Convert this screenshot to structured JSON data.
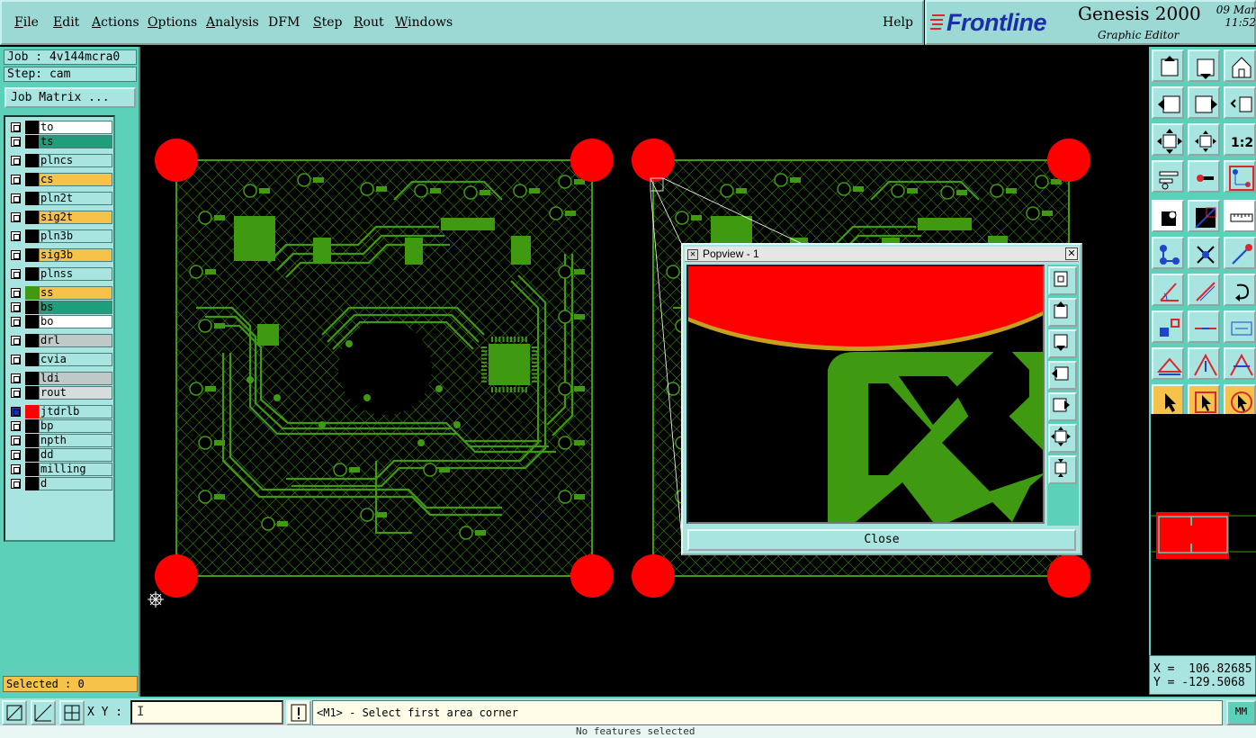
{
  "menubar": {
    "items": [
      {
        "label": "File",
        "u": "F",
        "rest": "ile"
      },
      {
        "label": "Edit",
        "u": "E",
        "rest": "dit"
      },
      {
        "label": "Actions",
        "u": "A",
        "rest": "ctions"
      },
      {
        "label": "Options",
        "u": "O",
        "rest": "ptions"
      },
      {
        "label": "Analysis",
        "u": "A",
        "rest": "nalysis"
      },
      {
        "label": "DFM",
        "u": "",
        "rest": "DFM"
      },
      {
        "label": "Step",
        "u": "S",
        "rest": "tep"
      },
      {
        "label": "Rout",
        "u": "R",
        "rest": "out"
      },
      {
        "label": "Windows",
        "u": "W",
        "rest": "indows"
      }
    ],
    "help": "Help"
  },
  "brand": {
    "logo": "Frontline",
    "title": "Genesis 2000",
    "subtitle": "Graphic Editor",
    "date": "09 Mar",
    "time": "11:52"
  },
  "job": {
    "job_line": "Job : 4v144mcra0",
    "step_line": "Step: cam",
    "matrix_button": "Job Matrix ..."
  },
  "layers": [
    {
      "name": "to",
      "bg": "#ffffff",
      "swatch": "#000000"
    },
    {
      "name": "ts",
      "bg": "#1e9e7a",
      "swatch": "#000000"
    },
    {
      "name": "plncs",
      "bg": "#a8e4e0",
      "swatch": "#000000"
    },
    {
      "name": "cs",
      "bg": "#f6c24a",
      "swatch": "#000000"
    },
    {
      "name": "pln2t",
      "bg": "#a8e4e0",
      "swatch": "#000000"
    },
    {
      "name": "sig2t",
      "bg": "#f6c24a",
      "swatch": "#000000"
    },
    {
      "name": "pln3b",
      "bg": "#a8e4e0",
      "swatch": "#000000"
    },
    {
      "name": "sig3b",
      "bg": "#f6c24a",
      "swatch": "#000000"
    },
    {
      "name": "plnss",
      "bg": "#a8e4e0",
      "swatch": "#000000"
    },
    {
      "name": "ss",
      "bg": "#f6c24a",
      "swatch": "#3f9a12"
    },
    {
      "name": "bs",
      "bg": "#1e9e7a",
      "swatch": "#000000"
    },
    {
      "name": "bo",
      "bg": "#ffffff",
      "swatch": "#000000"
    },
    {
      "name": "drl",
      "bg": "#c0c8c8",
      "swatch": "#000000"
    },
    {
      "name": "cvia",
      "bg": "#a8e4e0",
      "swatch": "#000000"
    },
    {
      "name": "ldi",
      "bg": "#c0c8c8",
      "swatch": "#000000"
    },
    {
      "name": "rout",
      "bg": "#d8dcdc",
      "swatch": "#000000"
    },
    {
      "name": "jtdrlb",
      "bg": "#a8e4e0",
      "swatch": "#ff0000"
    },
    {
      "name": "bp",
      "bg": "#a8e4e0",
      "swatch": "#000000"
    },
    {
      "name": "npth",
      "bg": "#a8e4e0",
      "swatch": "#000000"
    },
    {
      "name": "dd",
      "bg": "#a8e4e0",
      "swatch": "#000000"
    },
    {
      "name": "milling",
      "bg": "#a8e4e0",
      "swatch": "#000000"
    },
    {
      "name": "d",
      "bg": "#a8e4e0",
      "swatch": "#000000"
    }
  ],
  "selected": "Selected : 0",
  "coords": {
    "x": "X =  106.82685",
    "y": "Y = -129.5068"
  },
  "bottom": {
    "xy_label": "X Y :",
    "xy_value": "",
    "prompt": "<M1> - Select first area corner",
    "units": "MM",
    "status": "No features selected"
  },
  "popview": {
    "title": "Popview - 1",
    "close_label": "Close"
  },
  "colors": {
    "copper": "#3f9a12",
    "pad": "#ff0000",
    "panel": "#5cd0b8",
    "button": "#a8e4e0",
    "active": "#f6c24a"
  }
}
